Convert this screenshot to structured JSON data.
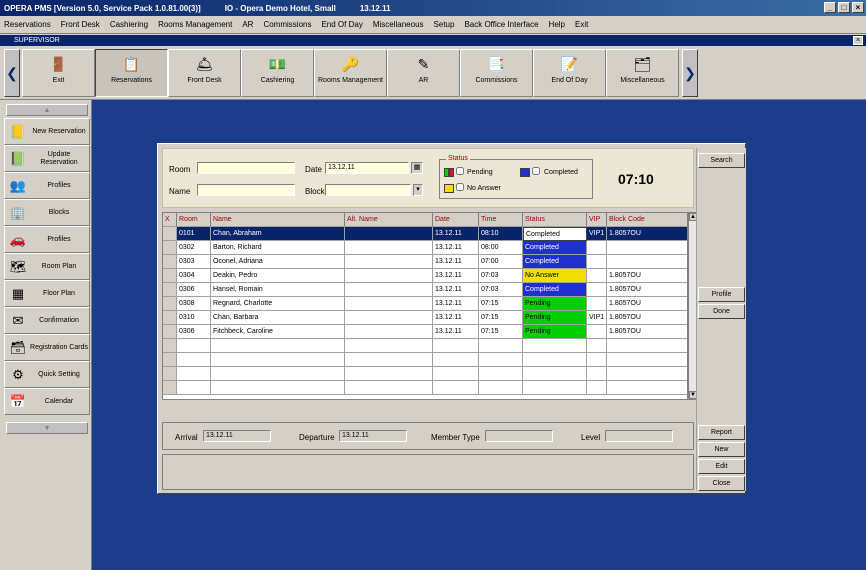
{
  "title_segments": [
    "OPERA PMS [Version 5.0, Service Pack 1.0.81.00(3)]",
    "IO - Opera Demo Hotel, Small",
    "13.12.11"
  ],
  "window_buttons": [
    "_",
    "□",
    "×"
  ],
  "menu": [
    "Reservations",
    "Front Desk",
    "Cashiering",
    "Rooms Management",
    "AR",
    "Commissions",
    "End Of Day",
    "Miscellaneous",
    "Setup",
    "Back Office Interface",
    "Help",
    "Exit"
  ],
  "subwindow": {
    "title": "SUPERVISOR",
    "close": "×"
  },
  "toolbar": {
    "left_arrow": "❮",
    "right_arrow": "❯",
    "items": [
      {
        "label": "Exit",
        "icon": "exit-door-icon",
        "glyph": "🚪"
      },
      {
        "label": "Reservations",
        "icon": "reservations-icon",
        "glyph": "📋",
        "active": true
      },
      {
        "label": "Front Desk",
        "icon": "front-desk-icon",
        "glyph": "🛎"
      },
      {
        "label": "Cashiering",
        "icon": "cashiering-icon",
        "glyph": "💵"
      },
      {
        "label": "Rooms Management",
        "icon": "rooms-management-icon",
        "glyph": "🔑"
      },
      {
        "label": "AR",
        "icon": "ar-icon",
        "glyph": "✎"
      },
      {
        "label": "Commissions",
        "icon": "commissions-icon",
        "glyph": "📑"
      },
      {
        "label": "End Of Day",
        "icon": "end-of-day-icon",
        "glyph": "📝"
      },
      {
        "label": "Miscellaneous",
        "icon": "miscellaneous-icon",
        "glyph": "🗂"
      }
    ]
  },
  "sidebar": {
    "scroll_up": "▲",
    "scroll_down": "▼",
    "items": [
      {
        "label": "New Reservation",
        "icon": "new-reservation-icon",
        "glyph": "📒"
      },
      {
        "label": "Update Reservation",
        "icon": "update-reservation-icon",
        "glyph": "📗"
      },
      {
        "label": "Profiles",
        "icon": "profiles-icon",
        "glyph": "👥"
      },
      {
        "label": "Blocks",
        "icon": "blocks-icon",
        "glyph": "🏢"
      },
      {
        "label": "Profiles",
        "icon": "profiles-alt-icon",
        "glyph": "🚗"
      },
      {
        "label": "Room Plan",
        "icon": "room-plan-icon",
        "glyph": "🗺"
      },
      {
        "label": "Floor Plan",
        "icon": "floor-plan-icon",
        "glyph": "▦"
      },
      {
        "label": "Confirmation",
        "icon": "confirmation-icon",
        "glyph": "✉"
      },
      {
        "label": "Registration Cards",
        "icon": "registration-cards-icon",
        "glyph": "🗃"
      },
      {
        "label": "Quick Setting",
        "icon": "quick-setting-icon",
        "glyph": "⚙"
      },
      {
        "label": "Calendar",
        "icon": "calendar-icon",
        "glyph": "📅"
      }
    ]
  },
  "search": {
    "room_label": "Room",
    "room_value": "",
    "date_label": "Date",
    "date_value": "13.12.11",
    "name_label": "Name",
    "name_value": "",
    "block_label": "Block",
    "block_value": "",
    "status_title": "Status",
    "status_pending": "Pending",
    "status_completed": "Completed",
    "status_no_answer": "No Answer",
    "time": "07:10"
  },
  "grid": {
    "headers": [
      "X",
      "Room",
      "Name",
      "Alt. Name",
      "Date",
      "Time",
      "Status",
      "VIP",
      "Block Code"
    ],
    "rows": [
      {
        "room": "0101",
        "name": "Chan, Abraham",
        "alt": "",
        "date": "13.12.11",
        "time": "08:10",
        "status": "Completed",
        "vip": "VIP1",
        "block": "1.8057OU",
        "status_color": "#ffffff",
        "selected": true
      },
      {
        "room": "0302",
        "name": "Barton, Richard",
        "alt": "",
        "date": "13.12.11",
        "time": "08:00",
        "status": "Completed",
        "vip": "",
        "block": "",
        "status_color": "#1f2fd0",
        "selected": false
      },
      {
        "room": "0303",
        "name": "Oconel, Adriana",
        "alt": "",
        "date": "13.12.11",
        "time": "07:00",
        "status": "Completed",
        "vip": "",
        "block": "",
        "status_color": "#1f2fd0",
        "selected": false
      },
      {
        "room": "0304",
        "name": "Deakin, Pedro",
        "alt": "",
        "date": "13.12.11",
        "time": "07:03",
        "status": "No Answer",
        "vip": "",
        "block": "1.8057OU",
        "status_color": "#f0e000",
        "selected": false
      },
      {
        "room": "0306",
        "name": "Hansel, Romain",
        "alt": "",
        "date": "13.12.11",
        "time": "07:03",
        "status": "Completed",
        "vip": "",
        "block": "1.8057OU",
        "status_color": "#1f2fd0",
        "selected": false
      },
      {
        "room": "0308",
        "name": "Regnard, Charlotte",
        "alt": "",
        "date": "13.12.11",
        "time": "07:15",
        "status": "Pending",
        "vip": "",
        "block": "1.8057OU",
        "status_color": "#00d000",
        "selected": false
      },
      {
        "room": "0310",
        "name": "Chan, Barbara",
        "alt": "",
        "date": "13.12.11",
        "time": "07:15",
        "status": "Pending",
        "vip": "VIP1",
        "block": "1.8057OU",
        "status_color": "#00d000",
        "selected": false
      },
      {
        "room": "0306",
        "name": "Fitchbeck, Caroline",
        "alt": "",
        "date": "13.12.11",
        "time": "07:15",
        "status": "Pending",
        "vip": "",
        "block": "1.8057OU",
        "status_color": "#00d000",
        "selected": false
      }
    ],
    "empty_rows": 4
  },
  "info": {
    "arrival_label": "Arrival",
    "arrival_value": "13.12.11",
    "departure_label": "Departure",
    "departure_value": "13.12.11",
    "member_type_label": "Member Type",
    "member_type_value": "",
    "level_label": "Level",
    "level_value": ""
  },
  "buttons": {
    "search": "Search",
    "profile": "Profile",
    "done": "Done",
    "report": "Report",
    "new": "New",
    "edit": "Edit",
    "close": "Close"
  },
  "colors": {
    "desktop": "#1c3c8c",
    "titlebar": "#0a246a",
    "completed": "#1f2fd0",
    "pending": "#00d000",
    "no_answer": "#f0e000",
    "selected_row": "#0a246a",
    "header_text": "#a00000"
  }
}
